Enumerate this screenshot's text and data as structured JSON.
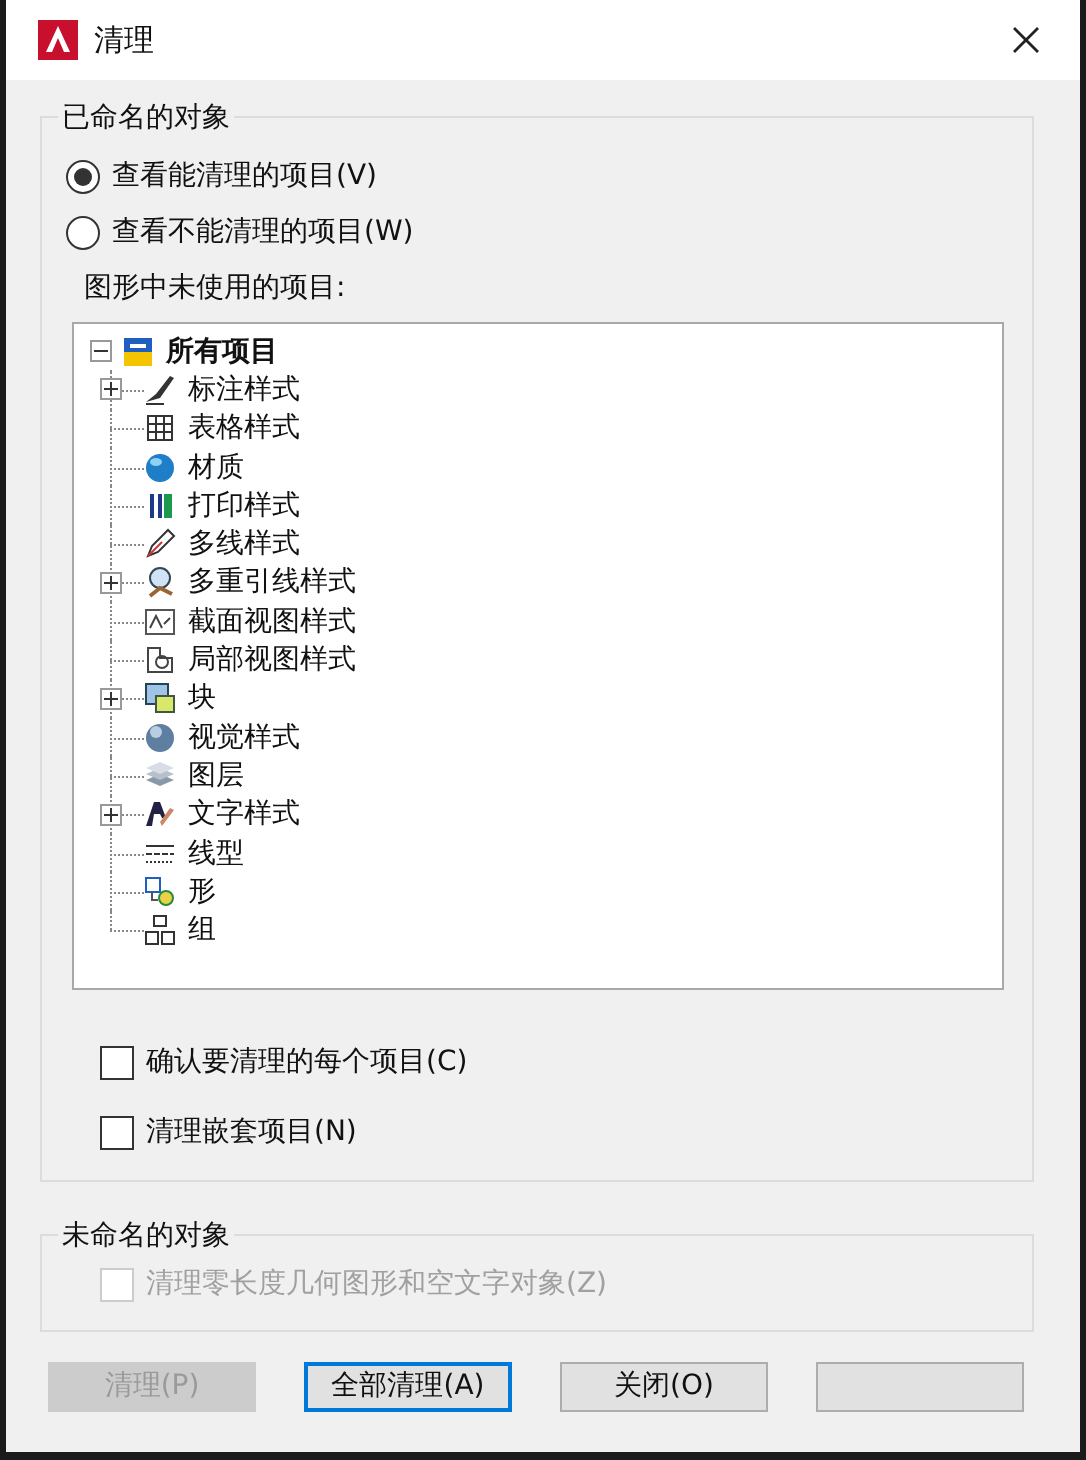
{
  "window": {
    "title": "清理"
  },
  "named_objects": {
    "title": "已命名的对象",
    "radios": [
      {
        "label": "查看能清理的项目(V)",
        "selected": true
      },
      {
        "label": "查看不能清理的项目(W)",
        "selected": false
      }
    ],
    "tree_label": "图形中未使用的项目:",
    "tree": {
      "label": "所有项目",
      "expanded": true,
      "children": [
        {
          "label": "标注样式",
          "expandable": true
        },
        {
          "label": "表格样式",
          "expandable": false
        },
        {
          "label": "材质",
          "expandable": false
        },
        {
          "label": "打印样式",
          "expandable": false
        },
        {
          "label": "多线样式",
          "expandable": false
        },
        {
          "label": "多重引线样式",
          "expandable": true
        },
        {
          "label": "截面视图样式",
          "expandable": false
        },
        {
          "label": "局部视图样式",
          "expandable": false
        },
        {
          "label": "块",
          "expandable": true
        },
        {
          "label": "视觉样式",
          "expandable": false
        },
        {
          "label": "图层",
          "expandable": false
        },
        {
          "label": "文字样式",
          "expandable": true
        },
        {
          "label": "线型",
          "expandable": false
        },
        {
          "label": "形",
          "expandable": false
        },
        {
          "label": "组",
          "expandable": false
        }
      ]
    },
    "checkboxes": [
      {
        "label": "确认要清理的每个项目(C)",
        "checked": false,
        "disabled": false
      },
      {
        "label": "清理嵌套项目(N)",
        "checked": false,
        "disabled": false
      }
    ]
  },
  "unnamed_objects": {
    "title": "未命名的对象",
    "checkboxes": [
      {
        "label": "清理零长度几何图形和空文字对象(Z)",
        "checked": false,
        "disabled": true
      }
    ]
  },
  "buttons": [
    {
      "label": "清理(P)",
      "disabled": true,
      "default": false
    },
    {
      "label": "全部清理(A)",
      "disabled": false,
      "default": true
    },
    {
      "label": "关闭(O)",
      "disabled": false,
      "default": false
    },
    {
      "disabled": false,
      "default": false
    }
  ]
}
